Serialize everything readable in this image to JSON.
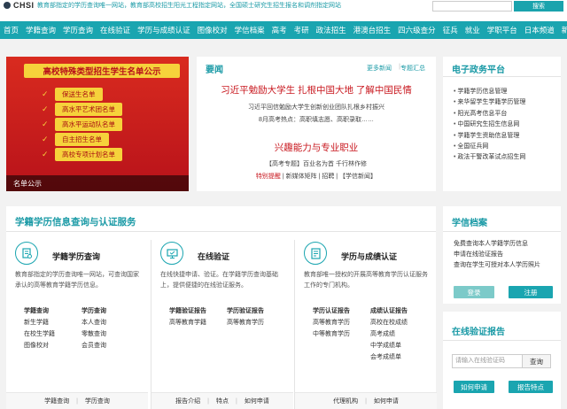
{
  "top": {
    "logo_text": "CHSI",
    "notice": "教育部指定的学历查询唯一网站，教育部高校招生阳光工程指定网站，全国硕士研究生招生报名和调剂指定网站",
    "search_button": "搜索"
  },
  "nav": [
    "首页",
    "学籍查询",
    "学历查询",
    "在线验证",
    "学历与成绩认证",
    "图像校对",
    "学信档案",
    "高考",
    "考研",
    "政法招生",
    "港澳台招生",
    "四六级查分",
    "征兵",
    "就业",
    "学职平台",
    "日本频道",
    "新职业"
  ],
  "banner": {
    "title": "高校特殊类型招生学生名单公示",
    "items": [
      "保送生名单",
      "高水平艺术团名单",
      "高水平运动队名单",
      "自主招生名单",
      "高校专项计划名单"
    ],
    "caption": "名单公示"
  },
  "news": {
    "title": "要闻",
    "more": "更多新闻",
    "sep": "|",
    "topics": "专题汇总",
    "headline1": "习近平勉励大学生 扎根中国大地 了解中国民情",
    "sub1": "习近平回信勉励大学生创新创业团队扎根乡村振兴",
    "sub2": "8月高考热点：高职填志愿、高职录取……",
    "headline2": "兴趣能力与专业职业",
    "sub3": "【高考专题】百业名为首 千行林作修",
    "sub4_red": "特别提醒",
    "sub4_rest": "| 新媒体矩阵 | 招聘 | 【学信新闻】"
  },
  "egov": {
    "title": "电子政务平台",
    "items": [
      "学籍学历信息管理",
      "来华留学生学籍学历管理",
      "阳光高考信息平台",
      "中国研究生招生信息网",
      "学籍学生资助信息管理",
      "全国征兵网",
      "政法干警改革试点招生网"
    ]
  },
  "services": {
    "title": "学籍学历信息查询与认证服务",
    "columns": [
      {
        "name": "学籍学历查询",
        "desc": "教育部指定的学历查询唯一网站，可查询国家承认的高等教育学籍学历信息。",
        "links": [
          "学籍查询",
          "学历查询",
          "新生学籍",
          "本人查询",
          "在校生学籍",
          "零散查询",
          "图像校对",
          "会员查询"
        ],
        "bold": [
          0,
          1
        ],
        "foot": [
          "学籍查询",
          "学历查询"
        ]
      },
      {
        "name": "在线验证",
        "desc": "在线快捷申请、验证。在学籍学历查询基础上，提供便捷的在线验证服务。",
        "links": [
          "学籍验证报告",
          "学历验证报告",
          "高等教育学籍",
          "高等教育学历"
        ],
        "bold": [
          0,
          1
        ],
        "foot": [
          "报告介绍",
          "特点",
          "如何申请"
        ]
      },
      {
        "name": "学历与成绩认证",
        "desc": "教育部唯一授权的开展高等教育学历认证服务工作的专门机构。",
        "links": [
          "学历认证报告",
          "成绩认证报告",
          "高等教育学历",
          "高校在校成绩",
          "中等教育学历",
          "高考成绩",
          "",
          "中学成绩单",
          "",
          "会考成绩单"
        ],
        "bold": [
          0,
          1
        ],
        "foot": [
          "代理机构",
          "如何申请"
        ]
      }
    ],
    "foot_sep": "|"
  },
  "archive": {
    "title": "学信档案",
    "items": [
      "免费查询本人学籍学历信息",
      "申请在线验证报告",
      "查询在学生可授对本人学历照片"
    ],
    "login": "登录",
    "register": "注册"
  },
  "verify": {
    "title": "在线验证报告",
    "placeholder": "请输入在线验证码",
    "query": "查询",
    "apply": "如何申请",
    "report": "报告特点"
  },
  "colors": {
    "accent": "#1aa5b0",
    "headline_red": "#c8171e",
    "banner_red": "#c8171e",
    "banner_yellow": "#f6d23b"
  }
}
